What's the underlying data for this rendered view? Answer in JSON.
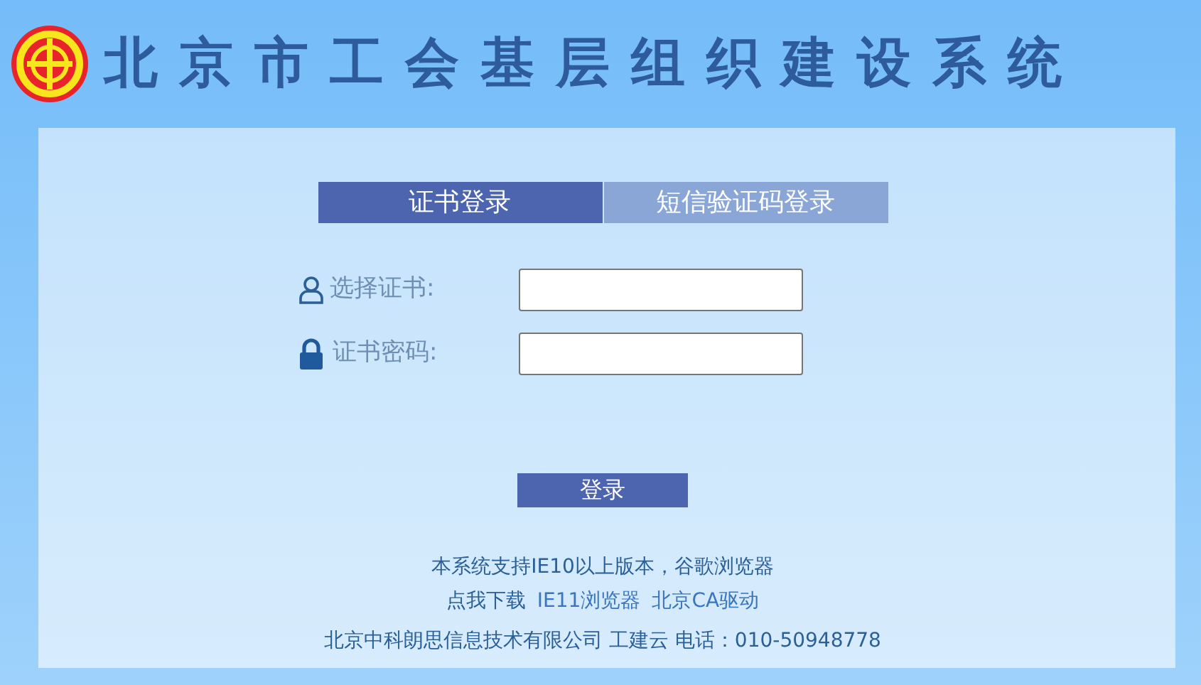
{
  "header": {
    "title": "北京市工会基层组织建设系统"
  },
  "tabs": [
    {
      "label": "证书登录",
      "selected": true
    },
    {
      "label": "短信验证码登录",
      "selected": false
    }
  ],
  "fields": [
    {
      "kind": "select",
      "label": "选择证书:"
    },
    {
      "kind": "password",
      "label": "证书密码:"
    }
  ],
  "login_button": "登录",
  "footer": {
    "support_text": "本系统支持IE10以上版本，谷歌浏览器",
    "download_prefix": "点我下载",
    "download_links": [
      "IE11浏览器",
      "北京CA驱动"
    ],
    "company": "北京中科朗思信息技术有限公司 工建云 电话：010-50948778"
  }
}
